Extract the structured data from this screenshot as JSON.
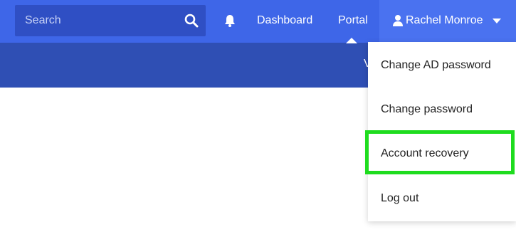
{
  "topbar": {
    "search": {
      "placeholder": "Search",
      "value": "",
      "icon": "search-icon"
    },
    "bell_icon": "bell-icon",
    "nav": [
      {
        "label": "Dashboard"
      },
      {
        "label": "Portal"
      }
    ],
    "user": {
      "name": "Rachel Monroe",
      "icon": "user-icon",
      "caret_icon": "caret-down-icon"
    }
  },
  "subbar": {
    "peek_text": "V"
  },
  "dropdown": {
    "items": [
      {
        "label": "Change AD password"
      },
      {
        "label": "Change password"
      },
      {
        "label": "Account recovery",
        "highlighted": true
      },
      {
        "label": "Log out"
      }
    ]
  },
  "colors": {
    "topbar": "#3e66e8",
    "subbar": "#2f4fb4",
    "search_bg": "#2f4fc4",
    "user_menu_bg": "#4a72f0",
    "highlight": "#1edc1e"
  }
}
